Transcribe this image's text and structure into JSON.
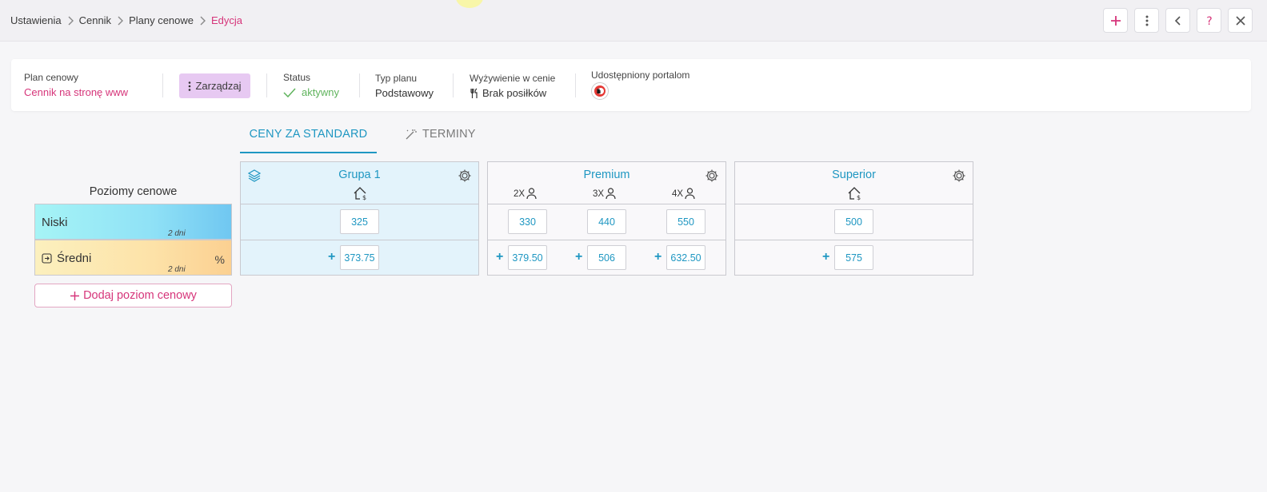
{
  "breadcrumb": [
    "Ustawienia",
    "Cennik",
    "Plany cenowe",
    "Edycja"
  ],
  "top_actions": [
    "plus-icon",
    "more-vertical-icon",
    "chevron-left-icon",
    "help-icon",
    "close-icon"
  ],
  "plan": {
    "label": "Plan cenowy",
    "name": "Cennik na stronę www",
    "manage_label": "Zarządzaj",
    "status_label": "Status",
    "status_value": "aktywny",
    "type_label": "Typ planu",
    "type_value": "Podstawowy",
    "meals_label": "Wyżywienie w cenie",
    "meals_value": "Brak posiłków",
    "portals_label": "Udostępniony portalom"
  },
  "tabs": [
    {
      "label": "CENY ZA STANDARD",
      "active": true
    },
    {
      "label": "TERMINY",
      "active": false
    }
  ],
  "levels": {
    "title": "Poziomy cenowe",
    "items": [
      {
        "name": "Niski",
        "days": "2 dni",
        "pct": ""
      },
      {
        "name": "Średni",
        "days": "2 dni",
        "pct": "%"
      }
    ],
    "add_label": "Dodaj poziom cenowy"
  },
  "rooms": [
    {
      "name": "Grupa 1",
      "occupancy": [],
      "row1": [
        "325"
      ],
      "row2": [
        "373.75"
      ]
    },
    {
      "name": "Premium",
      "occupancy": [
        "2X",
        "3X",
        "4X"
      ],
      "row1": [
        "330",
        "440",
        "550"
      ],
      "row2": [
        "379.50",
        "506",
        "632.50"
      ]
    },
    {
      "name": "Superior",
      "occupancy": [],
      "row1": [
        "500"
      ],
      "row2": [
        "575"
      ]
    }
  ],
  "colors": {
    "accent_pink": "#d6357a",
    "accent_blue": "#1f97c2",
    "status_green": "#5fb35c"
  }
}
